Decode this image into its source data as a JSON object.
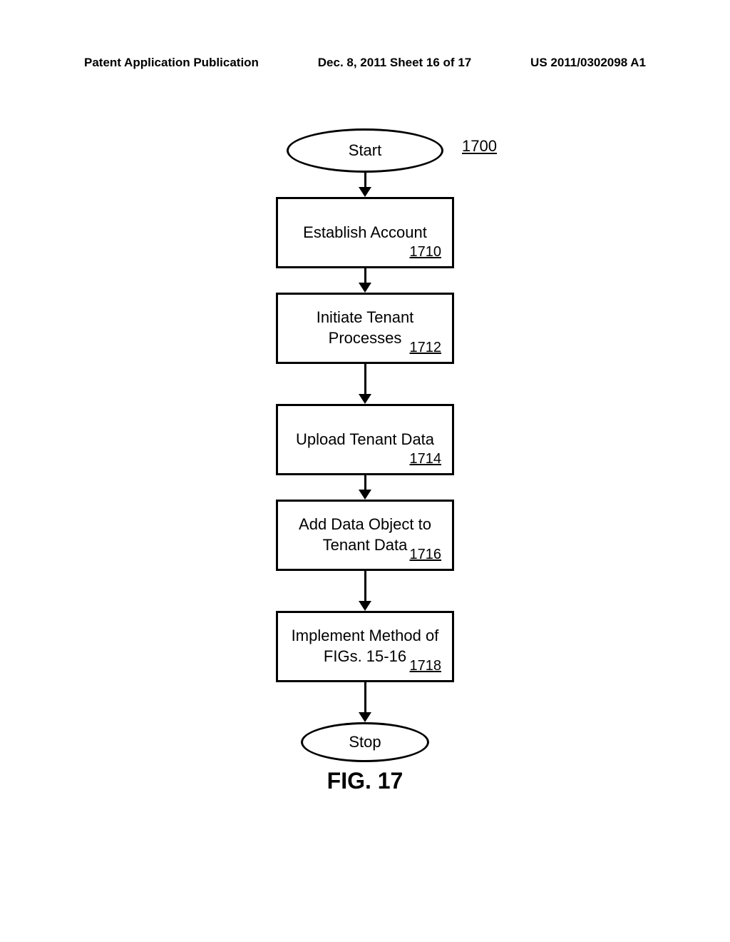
{
  "header": {
    "left": "Patent Application Publication",
    "center": "Dec. 8, 2011  Sheet 16 of 17",
    "right": "US 2011/0302098 A1"
  },
  "flowchart": {
    "start": {
      "label": "Start",
      "ref": "1700"
    },
    "steps": [
      {
        "text": "Establish Account",
        "ref": "1710"
      },
      {
        "text": "Initiate Tenant\nProcesses",
        "ref": "1712"
      },
      {
        "text": "Upload Tenant Data",
        "ref": "1714"
      },
      {
        "text": "Add Data Object to\nTenant Data",
        "ref": "1716"
      },
      {
        "text": "Implement Method of\nFIGs. 15-16",
        "ref": "1718"
      }
    ],
    "stop": {
      "label": "Stop"
    }
  },
  "caption": "FIG. 17"
}
